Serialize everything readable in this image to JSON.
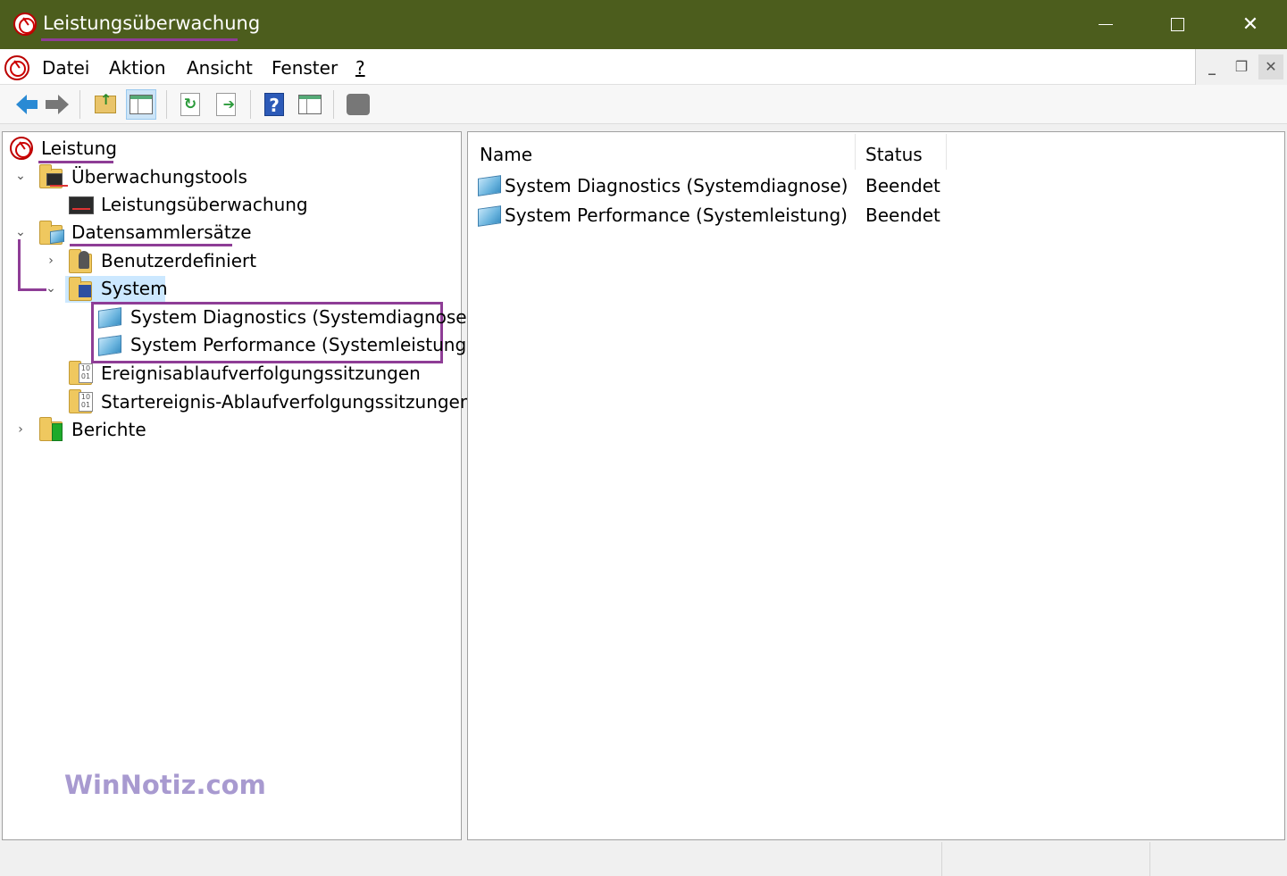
{
  "window": {
    "title": "Leistungsüberwachung",
    "title_bar_color": "#4c5d1d",
    "controls": {
      "minimize": "minimize-icon",
      "maximize": "maximize-icon",
      "close": "✕"
    }
  },
  "menu": {
    "items": [
      {
        "label": "Datei"
      },
      {
        "label": "Aktion"
      },
      {
        "label": "Ansicht"
      },
      {
        "label": "Fenster"
      },
      {
        "label": "?"
      }
    ],
    "mdi_controls": [
      "_",
      "❐",
      "✕"
    ]
  },
  "toolbar": {
    "buttons": [
      "back-arrow-icon",
      "forward-arrow-icon",
      "folder-up-icon",
      "show-hide-console-tree-icon",
      "refresh-icon",
      "export-list-icon",
      "help-icon",
      "show-action-pane-icon",
      "plugin-icon"
    ]
  },
  "tree": {
    "root": "Leistung",
    "items": [
      {
        "label": "Überwachungstools",
        "expanded": true
      },
      {
        "label": "Leistungsüberwachung"
      },
      {
        "label": "Datensammlersätze",
        "expanded": true
      },
      {
        "label": "Benutzerdefiniert",
        "expanded": false
      },
      {
        "label": "System",
        "expanded": true,
        "selected": true
      },
      {
        "label": "System Diagnostics (Systemdiagnose)"
      },
      {
        "label": "System Performance (Systemleistung)"
      },
      {
        "label": "Ereignisablaufverfolgungssitzungen"
      },
      {
        "label": "Startereignis-Ablaufverfolgungssitzungen"
      },
      {
        "label": "Berichte",
        "expanded": false
      }
    ]
  },
  "list": {
    "columns": [
      "Name",
      "Status"
    ],
    "rows": [
      {
        "name": "System Diagnostics (Systemdiagnose)",
        "status": "Beendet"
      },
      {
        "name": "System Performance (Systemleistung)",
        "status": "Beendet"
      }
    ]
  },
  "watermark": "WinNotiz.com",
  "colors": {
    "annotation": "#8e3d96",
    "selection": "#cce8ff"
  }
}
